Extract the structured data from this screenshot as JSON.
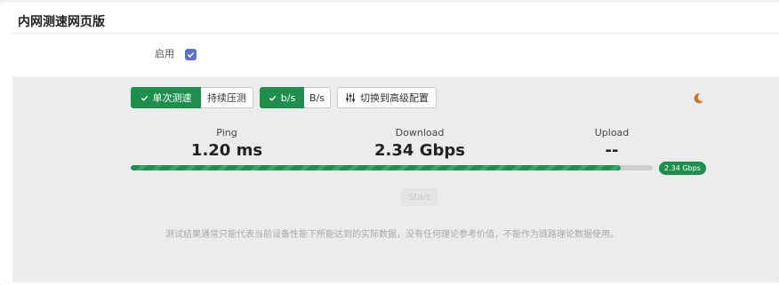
{
  "header": {
    "title": "内网测速网页版"
  },
  "settings": {
    "enable_label": "启用",
    "enabled": true
  },
  "toolbar": {
    "single_test_label": "单次测速",
    "continuous_test_label": "持续压测",
    "unit_bits_label": "b/s",
    "unit_bytes_label": "B/s",
    "advanced_config_label": "切换到高级配置"
  },
  "metrics": {
    "ping": {
      "label": "Ping",
      "value": "1.20 ms"
    },
    "download": {
      "label": "Download",
      "value": "2.34 Gbps"
    },
    "upload": {
      "label": "Upload",
      "value": "--"
    }
  },
  "progress": {
    "percent": 93.8,
    "badge": "2.34 Gbps"
  },
  "start_label": "Start",
  "disclaimer": "测试结果通常只能代表当前设备性能下所能达到的实际数据，没有任何理论参考价值，不能作为链路理论数据使用。",
  "colors": {
    "accent": "#1f8f4e",
    "checkbox": "#5b6fd6",
    "moon": "#c8762b"
  },
  "icons": {
    "checkbox": "check-icon",
    "adjust": "sliders-icon",
    "theme": "moon-icon"
  }
}
